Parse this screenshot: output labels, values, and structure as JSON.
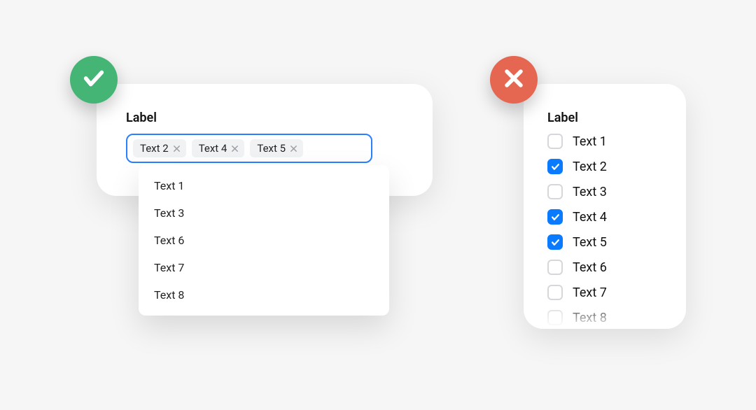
{
  "good": {
    "label": "Label",
    "selected": [
      "Text 2",
      "Text 4",
      "Text 5"
    ],
    "options": [
      "Text 1",
      "Text 3",
      "Text 6",
      "Text 7",
      "Text 8"
    ]
  },
  "bad": {
    "label": "Label",
    "items": [
      {
        "label": "Text 1",
        "checked": false
      },
      {
        "label": "Text 2",
        "checked": true
      },
      {
        "label": "Text 3",
        "checked": false
      },
      {
        "label": "Text 4",
        "checked": true
      },
      {
        "label": "Text 5",
        "checked": true
      },
      {
        "label": "Text 6",
        "checked": false
      },
      {
        "label": "Text 7",
        "checked": false
      },
      {
        "label": "Text 8",
        "checked": false
      }
    ]
  },
  "colors": {
    "good_badge": "#44b575",
    "bad_badge": "#e56651",
    "focus_border": "#2a7fff",
    "checkbox_checked": "#0a7bff"
  }
}
